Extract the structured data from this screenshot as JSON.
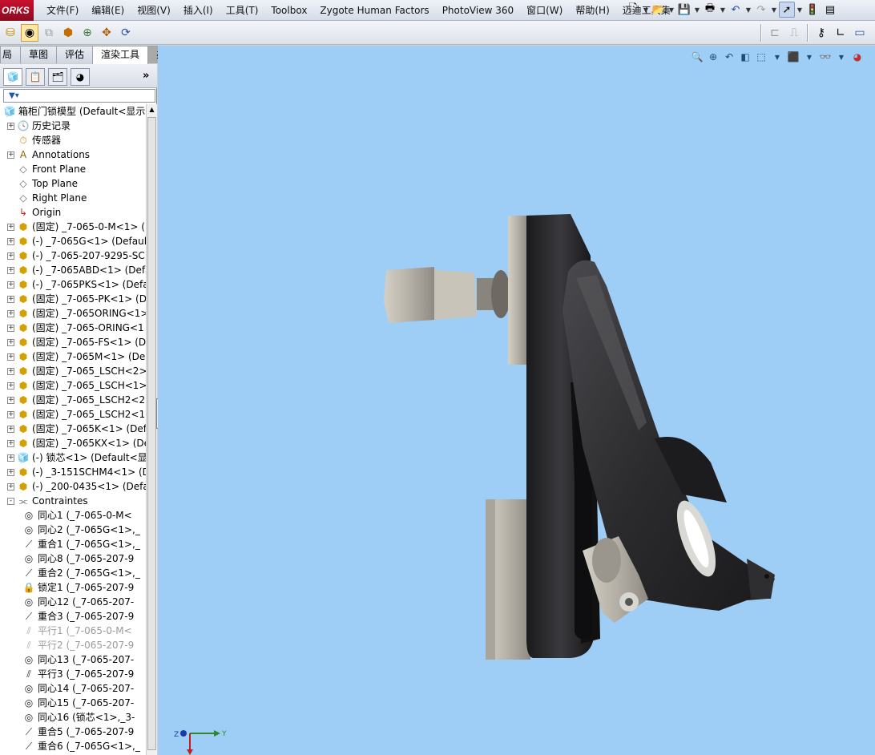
{
  "app": {
    "brand": "ORKS"
  },
  "menubar": {
    "items": [
      "文件(F)",
      "编辑(E)",
      "视图(V)",
      "插入(I)",
      "工具(T)",
      "Toolbox",
      "Zygote Human Factors",
      "PhotoView 360",
      "窗口(W)",
      "帮助(H)",
      "迈迪工具集"
    ]
  },
  "tabs": [
    "局",
    "草图",
    "评估",
    "渲染工具",
    "办公室产品"
  ],
  "active_tab": "渲染工具",
  "panel": {
    "more": "»",
    "filter_icon": "filter-icon"
  },
  "tree": [
    {
      "label": "箱柜门锁模型  (Default<显示",
      "icon": "assembly",
      "exp": "",
      "indent": 0
    },
    {
      "label": "历史记录",
      "icon": "history",
      "exp": "+",
      "indent": 1
    },
    {
      "label": "传感器",
      "icon": "sensor",
      "exp": "",
      "indent": 1
    },
    {
      "label": "Annotations",
      "icon": "annotation",
      "exp": "+",
      "indent": 1
    },
    {
      "label": "Front Plane",
      "icon": "plane",
      "exp": "",
      "indent": 1
    },
    {
      "label": "Top Plane",
      "icon": "plane",
      "exp": "",
      "indent": 1
    },
    {
      "label": "Right Plane",
      "icon": "plane",
      "exp": "",
      "indent": 1
    },
    {
      "label": "Origin",
      "icon": "origin",
      "exp": "",
      "indent": 1
    },
    {
      "label": "(固定) _7-065-0-M<1> (",
      "icon": "part",
      "exp": "+",
      "indent": 1
    },
    {
      "label": "(-) _7-065G<1> (Default",
      "icon": "part",
      "exp": "+",
      "indent": 1
    },
    {
      "label": "(-) _7-065-207-9295-SC",
      "icon": "part",
      "exp": "+",
      "indent": 1
    },
    {
      "label": "(-) _7-065ABD<1> (Defa",
      "icon": "part",
      "exp": "+",
      "indent": 1
    },
    {
      "label": "(-) _7-065PKS<1> (Defa",
      "icon": "part",
      "exp": "+",
      "indent": 1
    },
    {
      "label": "(固定) _7-065-PK<1> (D",
      "icon": "part",
      "exp": "+",
      "indent": 1
    },
    {
      "label": "(固定) _7-065ORING<1>",
      "icon": "part",
      "exp": "+",
      "indent": 1
    },
    {
      "label": "(固定) _7-065-ORING<1",
      "icon": "part",
      "exp": "+",
      "indent": 1
    },
    {
      "label": "(固定) _7-065-FS<1> (D",
      "icon": "part",
      "exp": "+",
      "indent": 1
    },
    {
      "label": "(固定) _7-065M<1> (De",
      "icon": "part",
      "exp": "+",
      "indent": 1
    },
    {
      "label": "(固定) _7-065_LSCH<2>",
      "icon": "part",
      "exp": "+",
      "indent": 1
    },
    {
      "label": "(固定) _7-065_LSCH<1>",
      "icon": "part",
      "exp": "+",
      "indent": 1
    },
    {
      "label": "(固定) _7-065_LSCH2<2:",
      "icon": "part",
      "exp": "+",
      "indent": 1
    },
    {
      "label": "(固定) _7-065_LSCH2<1:",
      "icon": "part",
      "exp": "+",
      "indent": 1
    },
    {
      "label": "(固定) _7-065K<1> (Def",
      "icon": "part",
      "exp": "+",
      "indent": 1
    },
    {
      "label": "(固定) _7-065KX<1> (De",
      "icon": "part",
      "exp": "+",
      "indent": 1
    },
    {
      "label": "(-) 锁芯<1> (Default<显",
      "icon": "subassembly",
      "exp": "+",
      "indent": 1
    },
    {
      "label": "(-) _3-151SCHM4<1> (D",
      "icon": "part",
      "exp": "+",
      "indent": 1
    },
    {
      "label": "(-) _200-0435<1> (Defa",
      "icon": "part",
      "exp": "+",
      "indent": 1
    },
    {
      "label": "Contraintes",
      "icon": "mates",
      "exp": "−",
      "indent": 1
    },
    {
      "label": "同心1 (_7-065-0-M<",
      "icon": "concentric",
      "exp": "",
      "indent": 2
    },
    {
      "label": "同心2 (_7-065G<1>,_",
      "icon": "concentric",
      "exp": "",
      "indent": 2
    },
    {
      "label": "重合1 (_7-065G<1>,_",
      "icon": "coincident",
      "exp": "",
      "indent": 2
    },
    {
      "label": "同心8 (_7-065-207-9",
      "icon": "concentric",
      "exp": "",
      "indent": 2
    },
    {
      "label": "重合2 (_7-065G<1>,_",
      "icon": "coincident",
      "exp": "",
      "indent": 2
    },
    {
      "label": "锁定1 (_7-065-207-9",
      "icon": "lock",
      "exp": "",
      "indent": 2
    },
    {
      "label": "同心12 (_7-065-207-",
      "icon": "concentric",
      "exp": "",
      "indent": 2
    },
    {
      "label": "重合3 (_7-065-207-9",
      "icon": "coincident",
      "exp": "",
      "indent": 2
    },
    {
      "label": "平行1 (_7-065-0-M<",
      "icon": "parallel-grey",
      "exp": "",
      "indent": 2,
      "grey": true
    },
    {
      "label": "平行2 (_7-065-207-9",
      "icon": "parallel-grey",
      "exp": "",
      "indent": 2,
      "grey": true
    },
    {
      "label": "同心13 (_7-065-207-",
      "icon": "concentric",
      "exp": "",
      "indent": 2
    },
    {
      "label": "平行3 (_7-065-207-9",
      "icon": "parallel",
      "exp": "",
      "indent": 2
    },
    {
      "label": "同心14 (_7-065-207-",
      "icon": "concentric",
      "exp": "",
      "indent": 2
    },
    {
      "label": "同心15 (_7-065-207-",
      "icon": "concentric",
      "exp": "",
      "indent": 2
    },
    {
      "label": "同心16 (锁芯<1>,_3-",
      "icon": "concentric",
      "exp": "",
      "indent": 2
    },
    {
      "label": "重合5 (_7-065-207-9",
      "icon": "coincident",
      "exp": "",
      "indent": 2
    },
    {
      "label": "重合6 (_7-065G<1>,_",
      "icon": "coincident",
      "exp": "",
      "indent": 2
    }
  ],
  "triad": {
    "z": "Z",
    "y": "Y"
  },
  "colors": {
    "viewport": "#9ecdf6",
    "part": "#2a2a2c",
    "metal": "#b9b5ad"
  }
}
